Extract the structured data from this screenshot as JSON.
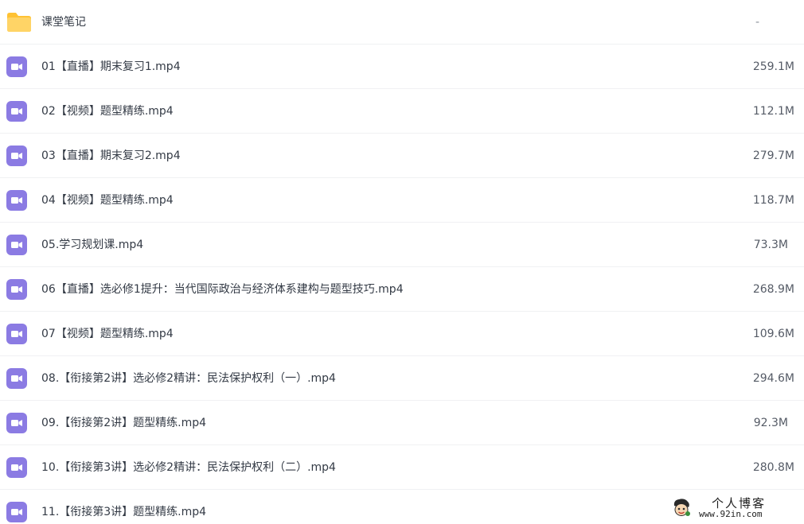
{
  "files": [
    {
      "name": "课堂笔记",
      "size": "-",
      "icon": "folder-icon"
    },
    {
      "name": "01【直播】期末复习1.mp4",
      "size": "259.1M",
      "icon": "video-file-icon"
    },
    {
      "name": "02【视频】题型精练.mp4",
      "size": "112.1M",
      "icon": "video-file-icon"
    },
    {
      "name": "03【直播】期末复习2.mp4",
      "size": "279.7M",
      "icon": "video-file-icon"
    },
    {
      "name": "04【视频】题型精练.mp4",
      "size": "118.7M",
      "icon": "video-file-icon"
    },
    {
      "name": "05.学习规划课.mp4",
      "size": "73.3M",
      "icon": "video-file-icon"
    },
    {
      "name": "06【直播】选必修1提升：当代国际政治与经济体系建构与题型技巧.mp4",
      "size": "268.9M",
      "icon": "video-file-icon"
    },
    {
      "name": "07【视频】题型精练.mp4",
      "size": "109.6M",
      "icon": "video-file-icon"
    },
    {
      "name": "08.【衔接第2讲】选必修2精讲：民法保护权利（一）.mp4",
      "size": "294.6M",
      "icon": "video-file-icon"
    },
    {
      "name": "09.【衔接第2讲】题型精练.mp4",
      "size": "92.3M",
      "icon": "video-file-icon"
    },
    {
      "name": "10.【衔接第3讲】选必修2精讲：民法保护权利（二）.mp4",
      "size": "280.8M",
      "icon": "video-file-icon"
    },
    {
      "name": "11.【衔接第3讲】题型精练.mp4",
      "size": "",
      "icon": "video-file-icon"
    }
  ],
  "watermark": {
    "title": "个人博客",
    "url": "www.92in.com",
    "icon": "mascot-icon"
  },
  "colors": {
    "folder": "#ffd466",
    "folder_tab": "#ffc233",
    "video_icon": "#8b7be3",
    "row_border": "#f0f1f3"
  }
}
